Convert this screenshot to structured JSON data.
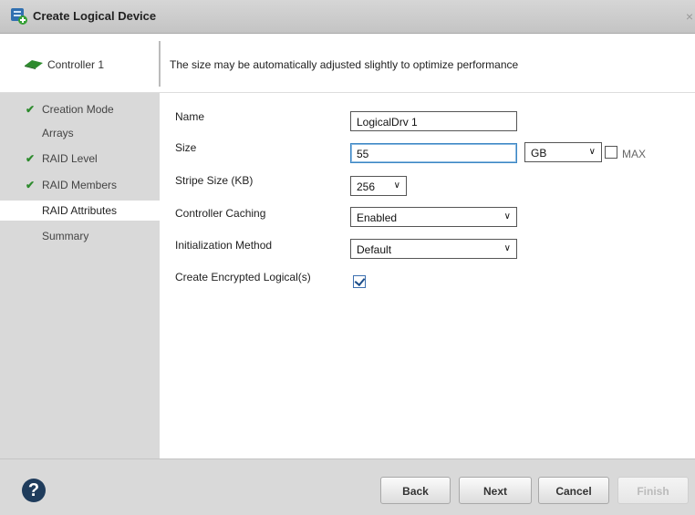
{
  "window": {
    "title": "Create Logical Device",
    "close_glyph": "×"
  },
  "header": {
    "controller_label": "Controller 1",
    "message": "The size may be automatically adjusted slightly to optimize performance"
  },
  "nav": [
    {
      "label": "Creation Mode",
      "done": true
    },
    {
      "label": "Arrays",
      "done": false
    },
    {
      "label": "RAID Level",
      "done": true
    },
    {
      "label": "RAID Members",
      "done": true
    },
    {
      "label": "RAID Attributes",
      "done": false,
      "active": true
    },
    {
      "label": "Summary",
      "done": false
    }
  ],
  "check_glyph": "✔",
  "form": {
    "name_label": "Name",
    "name_value": "LogicalDrv 1",
    "size_label": "Size",
    "size_value": "55",
    "size_unit": "GB",
    "max_label": "MAX",
    "max_checked": false,
    "stripe_label": "Stripe Size (KB)",
    "stripe_value": "256",
    "caching_label": "Controller Caching",
    "caching_value": "Enabled",
    "init_label": "Initialization Method",
    "init_value": "Default",
    "encrypt_label": "Create Encrypted Logical(s)",
    "encrypt_checked": true
  },
  "arrow_glyph": "∨",
  "footer": {
    "help_glyph": "?",
    "back_label": "Back",
    "next_label": "Next",
    "cancel_label": "Cancel",
    "finish_label": "Finish",
    "finish_enabled": false
  },
  "colors": {
    "accent": "#3b86c4",
    "check_green": "#2e8b2e",
    "sidebar_bg": "#d9d9d9"
  }
}
